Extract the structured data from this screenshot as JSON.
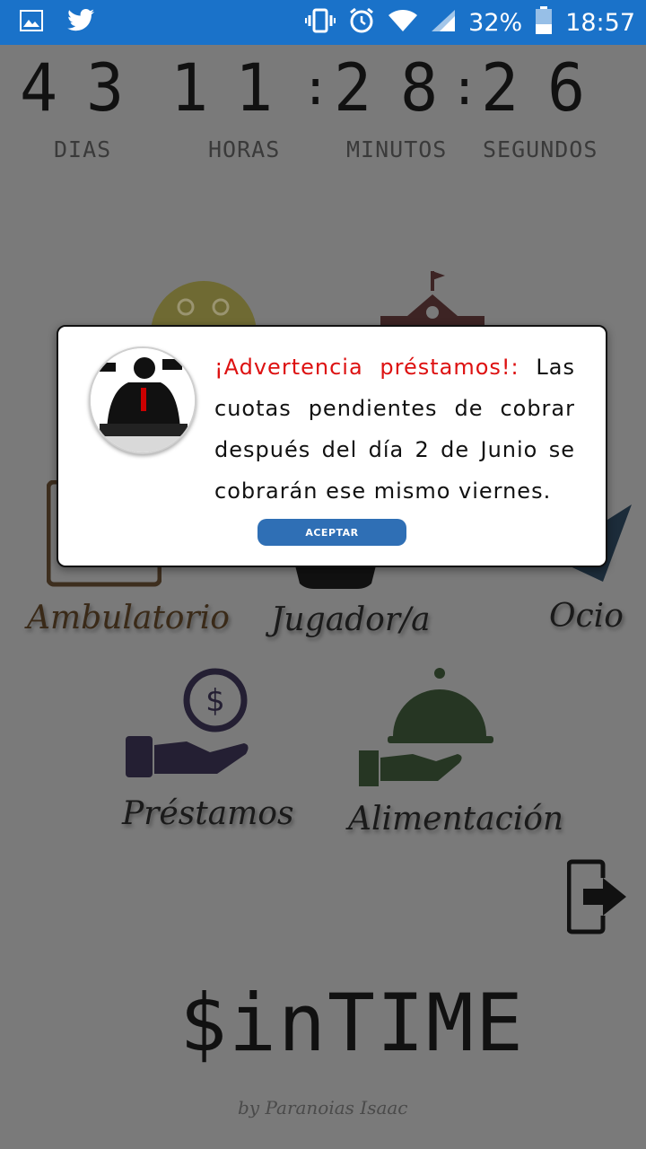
{
  "status_bar": {
    "battery": "32%",
    "time": "18:57",
    "icons": [
      "image-icon",
      "twitter-icon",
      "vibrate-icon",
      "alarm-icon",
      "wifi-icon",
      "signal-icon",
      "battery-icon"
    ]
  },
  "countdown": {
    "days": [
      "4",
      "3"
    ],
    "hours": [
      "1",
      "1"
    ],
    "separator": ":",
    "minutes": [
      "2",
      "8"
    ],
    "seconds": [
      "2",
      "6"
    ],
    "labels": {
      "days": "DIAS",
      "hours": "HORAS",
      "minutes": "MINUTOS",
      "seconds": "SEGUNDOS"
    }
  },
  "menu": {
    "ambulatorio": "Ambulatorio",
    "jugador": "Jugador/a",
    "ocio": "Ocio",
    "prestamos": "Préstamos",
    "alimentacion": "Alimentación"
  },
  "dialog": {
    "warning_title": "¡Advertencia préstamos!:",
    "message": " Las cuotas pendientes de cobrar después del día 2 de Junio se cobrarán ese mismo viernes.",
    "accept_label": "ACEPTAR"
  },
  "brand": {
    "title": "$inTIME",
    "byline": "by Paranoias Isaac"
  }
}
